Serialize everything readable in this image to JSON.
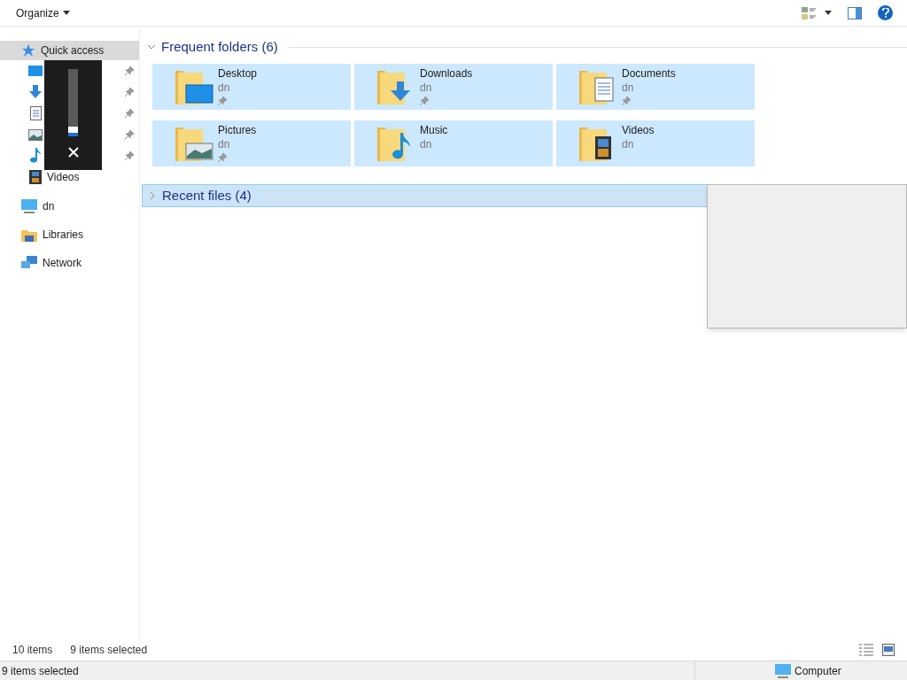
{
  "toolbar": {
    "organize": "Organize"
  },
  "sidebar": {
    "items": [
      {
        "label": "Quick access",
        "kind": "star",
        "selected": true,
        "children": [
          {
            "kind": "desktop",
            "pinned": true
          },
          {
            "kind": "downloads",
            "pinned": true
          },
          {
            "kind": "documents",
            "pinned": true
          },
          {
            "kind": "pictures",
            "pinned": true
          },
          {
            "kind": "music",
            "pinned": true
          },
          {
            "label": "Videos",
            "kind": "videos",
            "pinned": false
          }
        ]
      },
      {
        "label": "dn",
        "kind": "computer",
        "selected": false
      },
      {
        "label": "Libraries",
        "kind": "libraries",
        "selected": false
      },
      {
        "label": "Network",
        "kind": "network",
        "selected": false
      }
    ]
  },
  "overlay": {
    "level": 0.15
  },
  "groups": [
    {
      "title": "Frequent folders (6)",
      "expanded": true,
      "selected": false,
      "folders": [
        {
          "name": "Desktop",
          "sub": "dn",
          "kind": "desktop",
          "pinned": true,
          "selected": true
        },
        {
          "name": "Downloads",
          "sub": "dn",
          "kind": "downloads",
          "pinned": true,
          "selected": true
        },
        {
          "name": "Documents",
          "sub": "dn",
          "kind": "documents",
          "pinned": true,
          "selected": true
        },
        {
          "name": "Pictures",
          "sub": "dn",
          "kind": "pictures",
          "pinned": true,
          "selected": true
        },
        {
          "name": "Music",
          "sub": "dn",
          "kind": "music",
          "pinned": false,
          "selected": true
        },
        {
          "name": "Videos",
          "sub": "dn",
          "kind": "videos",
          "pinned": false,
          "selected": true
        }
      ]
    },
    {
      "title": "Recent files (4)",
      "expanded": false,
      "selected": true
    }
  ],
  "status": {
    "count": "10 items",
    "selection": "9 items selected"
  },
  "outer_status": {
    "selection": "9 items selected",
    "zone": "Computer"
  }
}
